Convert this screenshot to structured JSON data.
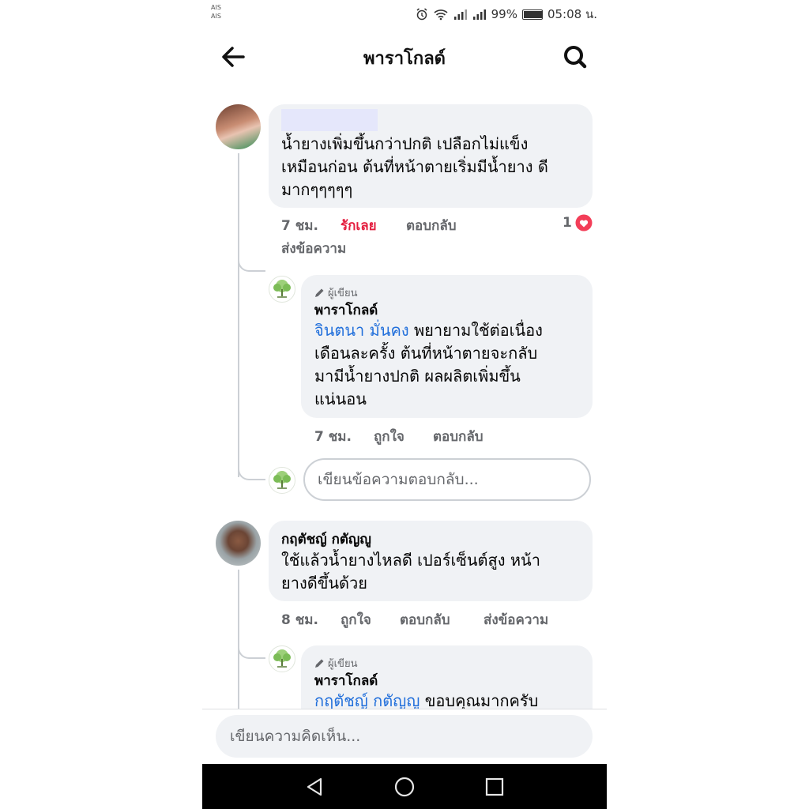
{
  "status_bar": {
    "carrier_1": "AIS",
    "carrier_2": "AIS",
    "battery": "99%",
    "time": "05:08 น."
  },
  "header": {
    "title": "พาราโกลด์",
    "back_icon": "arrow-left-icon",
    "search_icon": "search-icon"
  },
  "comments": [
    {
      "text_lines": [
        "น้ำยางเพิ่มขึ้นกว่าปกติ เปลือกไม่แข็ง",
        "เหมือนก่อน ต้นที่หน้าตายเริ่มมีน้ำยาง ดี",
        "มากๆๆๆๆๆ"
      ],
      "time": "7 ชม.",
      "like": "รักเลย",
      "reply": "ตอบกลับ",
      "message": "ส่งข้อความ",
      "reaction_count": "1",
      "reaction_icon": "love-reaction-icon",
      "reply_comment": {
        "author_tag": "ผู้เขียน",
        "author": "พาราโกลด์",
        "mention": "จินตนา มั่นคง",
        "text_lines": [
          " พยายามใช้ต่อเนื่อง",
          "เดือนละครั้ง ต้นที่หน้าตายจะกลับ",
          "มามีน้ำยางปกติ ผลผลิตเพิ่มขึ้น",
          "แน่นอน"
        ],
        "time": "7 ชม.",
        "like": "ถูกใจ",
        "reply": "ตอบกลับ"
      },
      "reply_input_placeholder": "เขียนข้อความตอบกลับ..."
    },
    {
      "author": "กฤตัชญ์ กตัญญู",
      "text_lines": [
        "ใช้แล้วน้ำยางไหลดี เปอร์เซ็นต์สูง หน้า",
        "ยางดีขึ้นด้วย"
      ],
      "time": "8 ชม.",
      "like": "ถูกใจ",
      "reply": "ตอบกลับ",
      "message": "ส่งข้อความ",
      "reply_comment": {
        "author_tag": "ผู้เขียน",
        "author": "พาราโกลด์",
        "mention": "กฤตัชญ์ กตัญญู",
        "text": " ขอบคุณมากครับ"
      }
    }
  ],
  "composer": {
    "placeholder": "เขียนความคิดเห็น..."
  },
  "navbar": {
    "back": "nav-back-icon",
    "home": "nav-home-icon",
    "recents": "nav-recents-icon"
  },
  "colors": {
    "bubble": "#f0f2f5",
    "link": "#216fdb",
    "love": "#e41e3f",
    "meta": "#65676b"
  }
}
